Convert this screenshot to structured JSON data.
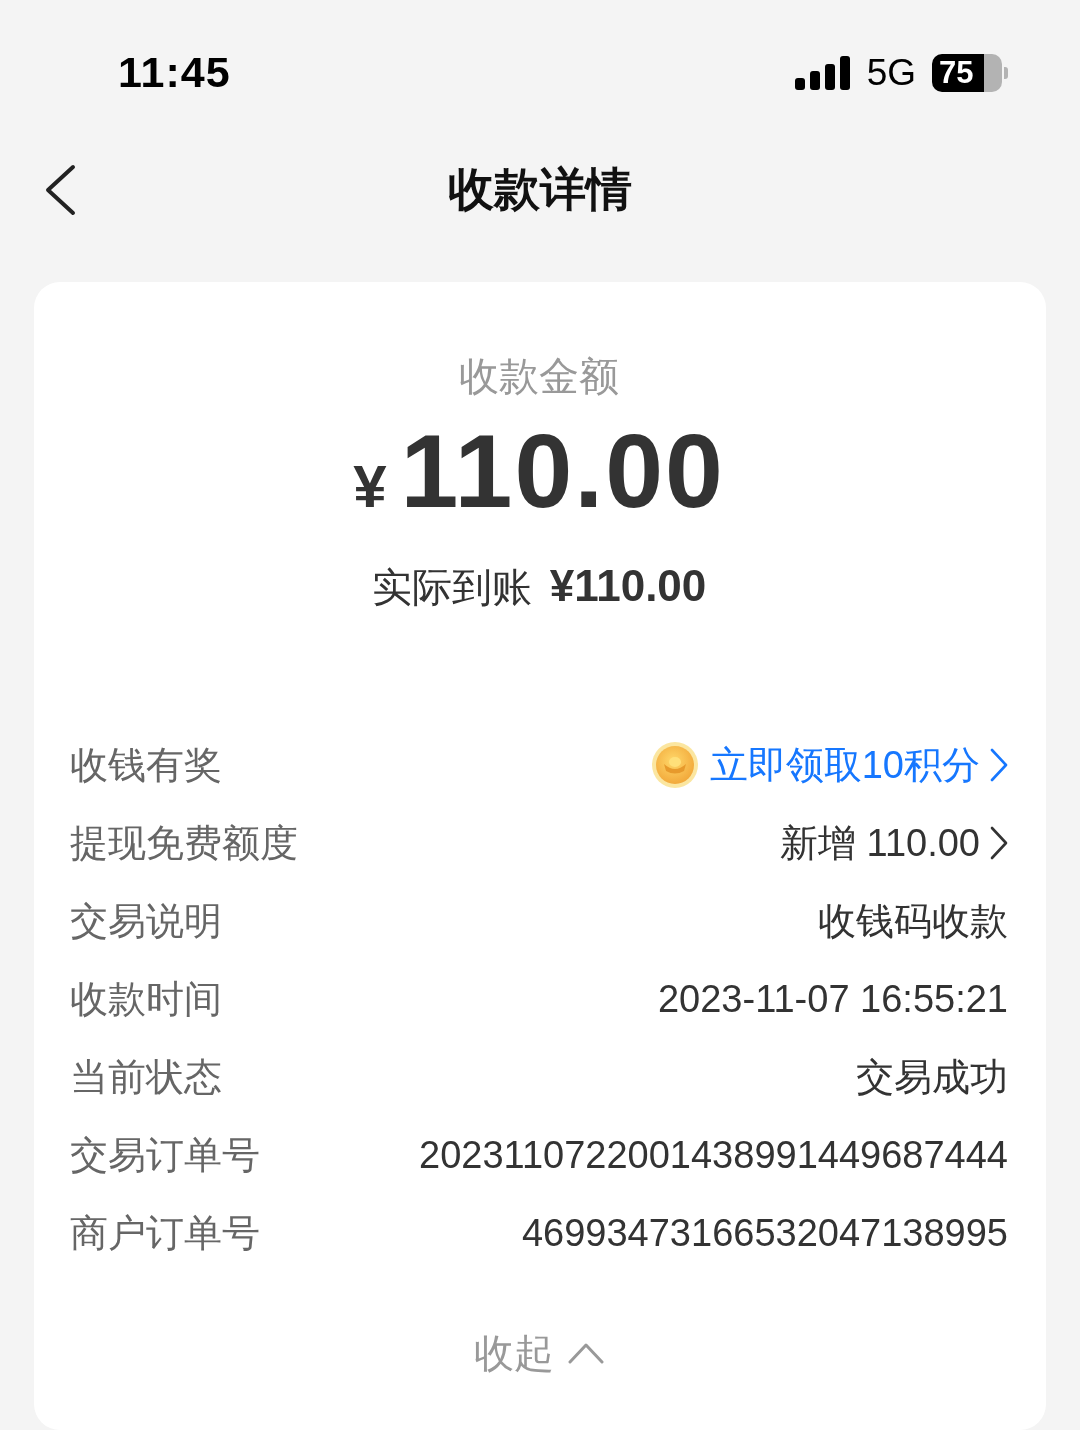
{
  "status_bar": {
    "time": "11:45",
    "network": "5G",
    "battery": "75"
  },
  "nav": {
    "title": "收款详情"
  },
  "summary": {
    "label": "收款金额",
    "currency": "¥",
    "amount": "110.00",
    "received_label": "实际到账",
    "received_amount": "¥110.00"
  },
  "details": [
    {
      "kind": "reward",
      "label": "收钱有奖",
      "value": "立即领取10积分"
    },
    {
      "kind": "link",
      "label": "提现免费额度",
      "value": "新增 110.00"
    },
    {
      "kind": "plain",
      "label": "交易说明",
      "value": "收钱码收款"
    },
    {
      "kind": "plain",
      "label": "收款时间",
      "value": "2023-11-07 16:55:21"
    },
    {
      "kind": "plain",
      "label": "当前状态",
      "value": "交易成功"
    },
    {
      "kind": "plain",
      "label": "交易订单号",
      "value": "2023110722001438991449687444"
    },
    {
      "kind": "plain",
      "label": "商户订单号",
      "value": "46993473166532047138995"
    }
  ],
  "collapse": {
    "label": "收起"
  }
}
